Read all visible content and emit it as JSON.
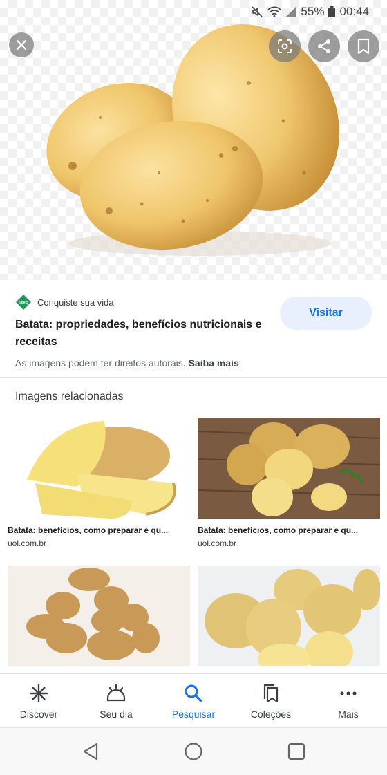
{
  "status_bar": {
    "battery": "55%",
    "time": "00:44"
  },
  "hero": {
    "close_icon": "close-icon",
    "actions": [
      "lens-icon",
      "share-icon",
      "bookmark-icon"
    ]
  },
  "result": {
    "source_name": "Conquiste sua vida",
    "source_logo_text": "taeq",
    "title": "Batata: propriedades, benefícios nutricionais e receitas",
    "visit_label": "Visitar",
    "rights_text": "As imagens podem ter direitos autorais.",
    "rights_link": "Saiba mais"
  },
  "related": {
    "heading": "Imagens relacionadas",
    "items": [
      {
        "caption": "Batata: benefícios, como preparar e qu...",
        "domain": "uol.com.br"
      },
      {
        "caption": "Batata: benefícios, como preparar e qu...",
        "domain": "uol.com.br"
      },
      {
        "caption": "",
        "domain": ""
      },
      {
        "caption": "",
        "domain": ""
      }
    ]
  },
  "bottom_nav": {
    "items": [
      {
        "label": "Discover",
        "icon": "asterisk-icon"
      },
      {
        "label": "Seu dia",
        "icon": "sunrise-icon"
      },
      {
        "label": "Pesquisar",
        "icon": "search-icon",
        "active": true
      },
      {
        "label": "Coleções",
        "icon": "collections-icon"
      },
      {
        "label": "Mais",
        "icon": "more-icon"
      }
    ]
  },
  "colors": {
    "accent": "#1a73e8",
    "visit_bg": "#e8f0fe",
    "logo_green": "#1e9b5a"
  }
}
